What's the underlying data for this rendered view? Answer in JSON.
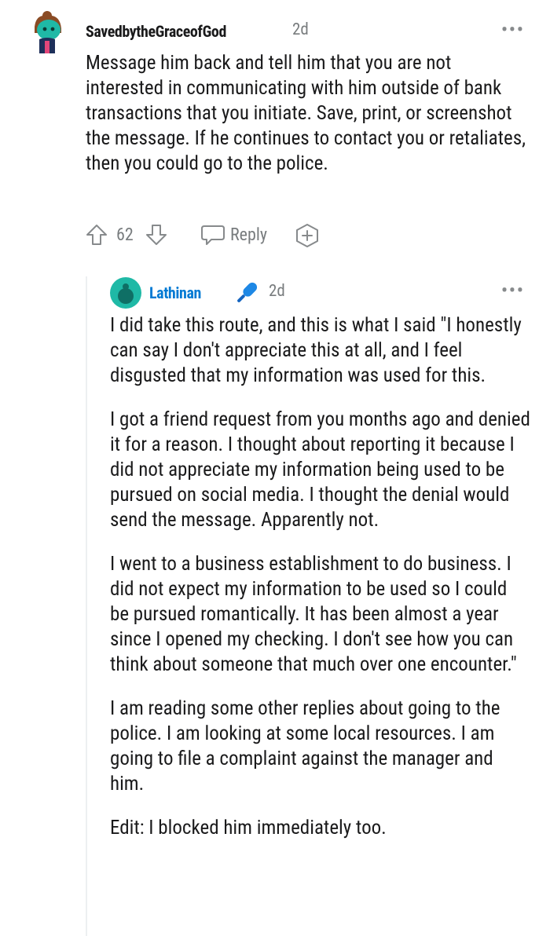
{
  "comment": {
    "username": "SavedbytheGraceofGod",
    "time": "2d",
    "more": "•••",
    "body": [
      "Message him back and tell him that you are not interested in communicating with him outside of bank transactions that you initiate. Save, print, or screenshot the message. If he continues to contact you or retaliates, then you could go to the police."
    ],
    "votes": "62",
    "reply_label": "Reply",
    "avatar_icon": "snoo-avatar-icon",
    "colors": {
      "accent": "#0079d3",
      "meta": "#787c7e",
      "thread": "#edeff1"
    }
  },
  "reply": {
    "username": "Lathinan",
    "time": "2d",
    "more": "•••",
    "flair_icon": "microphone-icon",
    "paragraphs": [
      "I did take this route, and this is what I said \"I honestly can say I don't appreciate this at all, and I feel disgusted that my information was used for this.",
      "I got a friend request from you months ago and denied it for a reason. I thought about reporting it because I did not appreciate my information being used to be pursued on social media. I thought the denial would send the message. Apparently not.",
      "I went to a business establishment to do business. I did not expect my information to be used so I could be pursued romantically. It has been almost a year since I opened my checking. I don't see how you can think about someone that much over one encounter.\"",
      "I am reading some other replies about going to the police. I am looking at some local resources. I am going to file a complaint against the manager and him.",
      "Edit: I blocked him immediately too."
    ]
  }
}
